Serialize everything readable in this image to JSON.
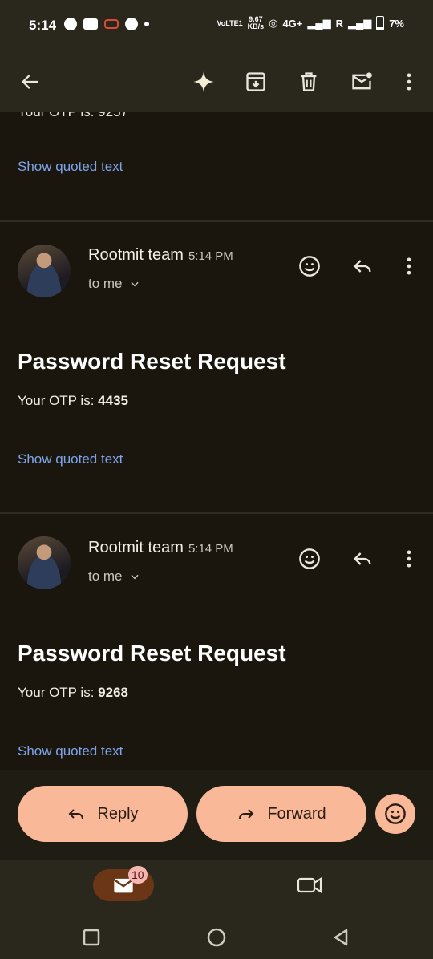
{
  "status_bar": {
    "time": "5:14",
    "volte": "VoLTE1",
    "speed_value": "9.67",
    "speed_unit": "KB/s",
    "network": "4G+",
    "roaming": "R",
    "battery": "7%"
  },
  "toolbar": {
    "back": "back-arrow-icon",
    "gemini": "sparkle-icon",
    "archive": "archive-icon",
    "delete": "trash-icon",
    "mark_unread": "mark-unread-icon",
    "more": "more-vertical-icon"
  },
  "prev_message": {
    "cut_text": "Your OTP is: 9257",
    "show_quoted": "Show quoted text"
  },
  "messages": [
    {
      "sender": "Rootmit team",
      "time": "5:14 PM",
      "to": "to me",
      "subject": "Password Reset Request",
      "otp_label": "Your OTP is: ",
      "otp_value": "4435",
      "show_quoted": "Show quoted text"
    },
    {
      "sender": "Rootmit team",
      "time": "5:14 PM",
      "to": "to me",
      "subject": "Password Reset Request",
      "otp_label": "Your OTP is: ",
      "otp_value": "9268",
      "show_quoted": "Show quoted text"
    }
  ],
  "actions": {
    "reply": "Reply",
    "forward": "Forward"
  },
  "bottom_nav": {
    "mail_badge": "10"
  },
  "colors": {
    "background": "#1a160d",
    "bar": "#2a271c",
    "accent_pill": "#f9b898",
    "link": "#7da4ea"
  }
}
